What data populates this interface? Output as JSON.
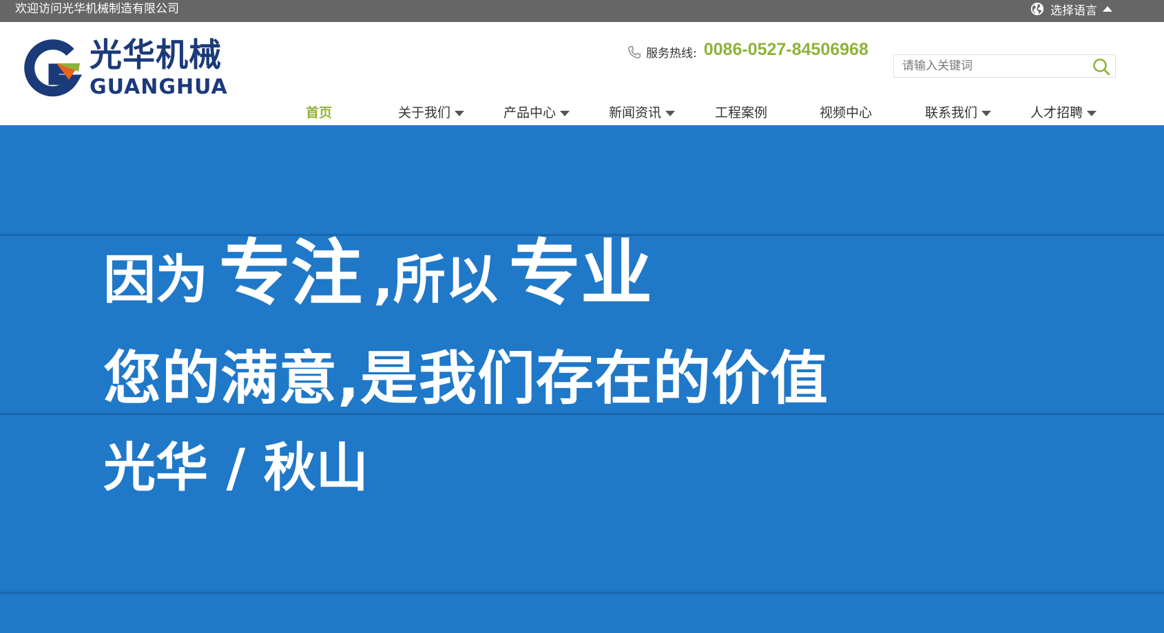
{
  "topbar": {
    "welcome": "欢迎访问光华机械制造有限公司",
    "language_label": "选择语言"
  },
  "logo": {
    "cn": "光华机械",
    "en": "GUANGHUA"
  },
  "hotline": {
    "label": "服务热线:",
    "number": "0086-0527-84506968"
  },
  "search": {
    "placeholder": "请输入关键词"
  },
  "nav": {
    "items": [
      {
        "label": "首页",
        "active": true,
        "dropdown": false
      },
      {
        "label": "关于我们",
        "active": false,
        "dropdown": true
      },
      {
        "label": "产品中心",
        "active": false,
        "dropdown": true
      },
      {
        "label": "新闻资讯",
        "active": false,
        "dropdown": true
      },
      {
        "label": "工程案例",
        "active": false,
        "dropdown": false
      },
      {
        "label": "视频中心",
        "active": false,
        "dropdown": false
      },
      {
        "label": "联系我们",
        "active": false,
        "dropdown": true
      },
      {
        "label": "人才招聘",
        "active": false,
        "dropdown": true
      }
    ]
  },
  "banner": {
    "line1_a": "因为",
    "line1_b": "专注",
    "line1_c": ",所以",
    "line1_d": "专业",
    "line2": "您的满意,是我们存在的价值",
    "line3": "光华 / 秋山"
  },
  "colors": {
    "topbar": "#666666",
    "accent_green": "#8fb23a",
    "brand_blue": "#1b3a7a",
    "banner_blue": "#1f78c8"
  }
}
